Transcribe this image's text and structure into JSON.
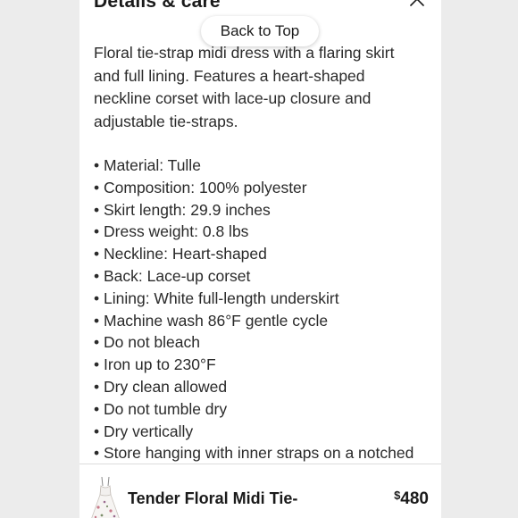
{
  "section": {
    "title": "Details & care",
    "collapse_icon": "chevron-up-icon"
  },
  "back_to_top": {
    "label": "Back to Top"
  },
  "description": {
    "lines": [
      "Floral tie-strap midi dress with a flaring skirt",
      "and full lining. Features a heart-shaped",
      "neckline corset with lace-up closure and",
      "adjustable tie-straps."
    ]
  },
  "features": [
    "Material: Tulle",
    "Composition: 100% polyester",
    "Skirt length: 29.9 inches",
    "Dress weight: 0.8 lbs",
    "Neckline: Heart-shaped",
    "Back: Lace-up corset",
    "Lining: White full-length underskirt",
    "Machine wash 86°F gentle cycle",
    "Do not bleach",
    "Iron up to 230°F",
    "Dry clean allowed",
    "Do not tumble dry",
    "Dry vertically",
    "Store hanging with inner straps on a notched"
  ],
  "product_bar": {
    "name": "Tender Floral Midi Tie-",
    "currency": "$",
    "price": "480",
    "thumbnail_icon": "dress-thumbnail"
  },
  "colors": {
    "background": "#ececec",
    "panel": "#ffffff",
    "text": "#2a2a2a",
    "heading": "#1a1a1a"
  }
}
